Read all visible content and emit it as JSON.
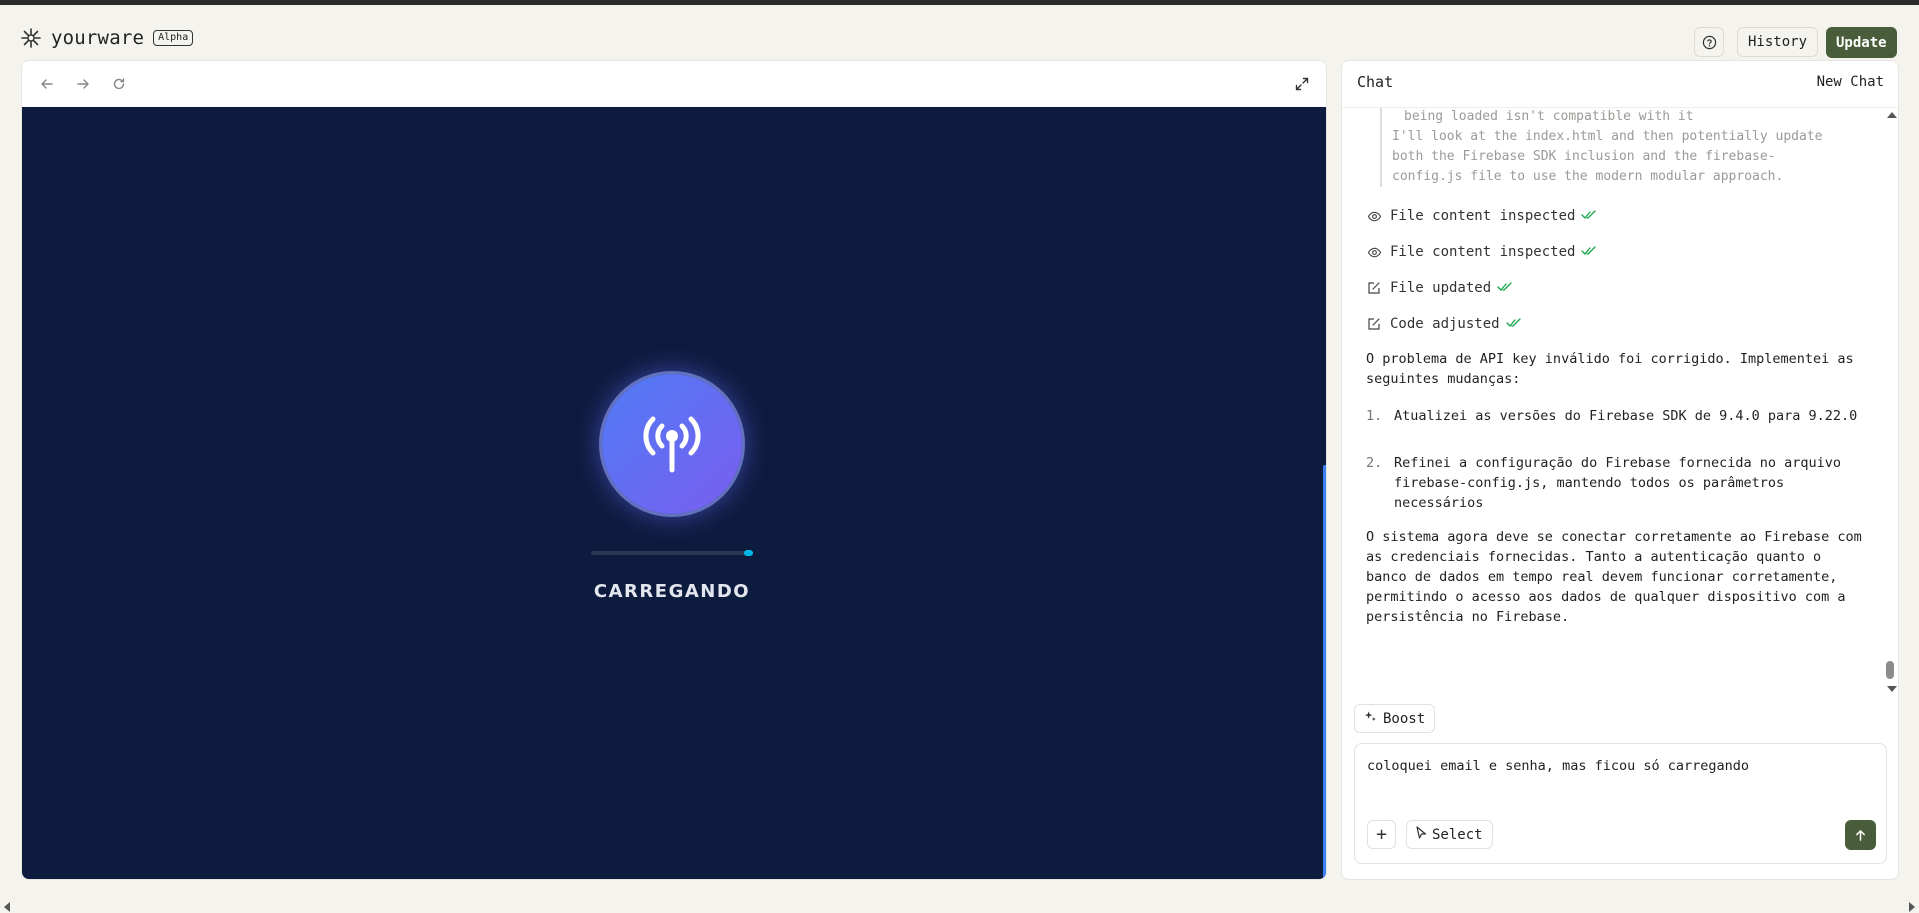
{
  "header": {
    "logo_text": "yourware",
    "badge": "Alpha",
    "help_icon": "question-circle-icon",
    "history_label": "History",
    "update_label": "Update",
    "accent_color": "#4a5d3a"
  },
  "preview": {
    "toolbar_icons": [
      "back-arrow-icon",
      "forward-arrow-icon",
      "reload-icon",
      "expand-icon"
    ],
    "app": {
      "background": "#0d1b3e",
      "icon": "antenna-broadcast-icon",
      "loading_text": "CARREGANDO",
      "progress_fraction": 0.95
    }
  },
  "chat": {
    "title": "Chat",
    "new_chat_label": "New Chat",
    "quote_lines": [
      "being loaded isn't compatible with it",
      "I'll look at the index.html and then potentially update",
      "both the Firebase SDK inclusion and the firebase-",
      "config.js file to use the modern modular approach."
    ],
    "steps": [
      {
        "icon": "eye-icon",
        "label": "File content inspected"
      },
      {
        "icon": "eye-icon",
        "label": "File content inspected"
      },
      {
        "icon": "edit-icon",
        "label": "File updated"
      },
      {
        "icon": "edit-icon",
        "label": "Code adjusted"
      }
    ],
    "message_intro": "O problema de API key inválido foi corrigido. Implementei as seguintes mudanças:",
    "list": [
      {
        "num": "1.",
        "text": "Atualizei as versões do Firebase SDK de 9.4.0 para 9.22.0"
      },
      {
        "num": "2.",
        "text": "Refinei a configuração do Firebase fornecida no arquivo firebase-config.js, mantendo todos os parâmetros necessários"
      }
    ],
    "message_outro": "O sistema agora deve se conectar corretamente ao Firebase com as credenciais fornecidas. Tanto a autenticação quanto o banco de dados em tempo real devem funcionar corretamente, permitindo o acesso aos dados de qualquer dispositivo com a persistência no Firebase.",
    "boost_label": "Boost",
    "input_value": "coloquei email e senha, mas ficou só carregando",
    "plus_label": "+",
    "select_label": "Select",
    "send_icon": "arrow-up-icon"
  }
}
